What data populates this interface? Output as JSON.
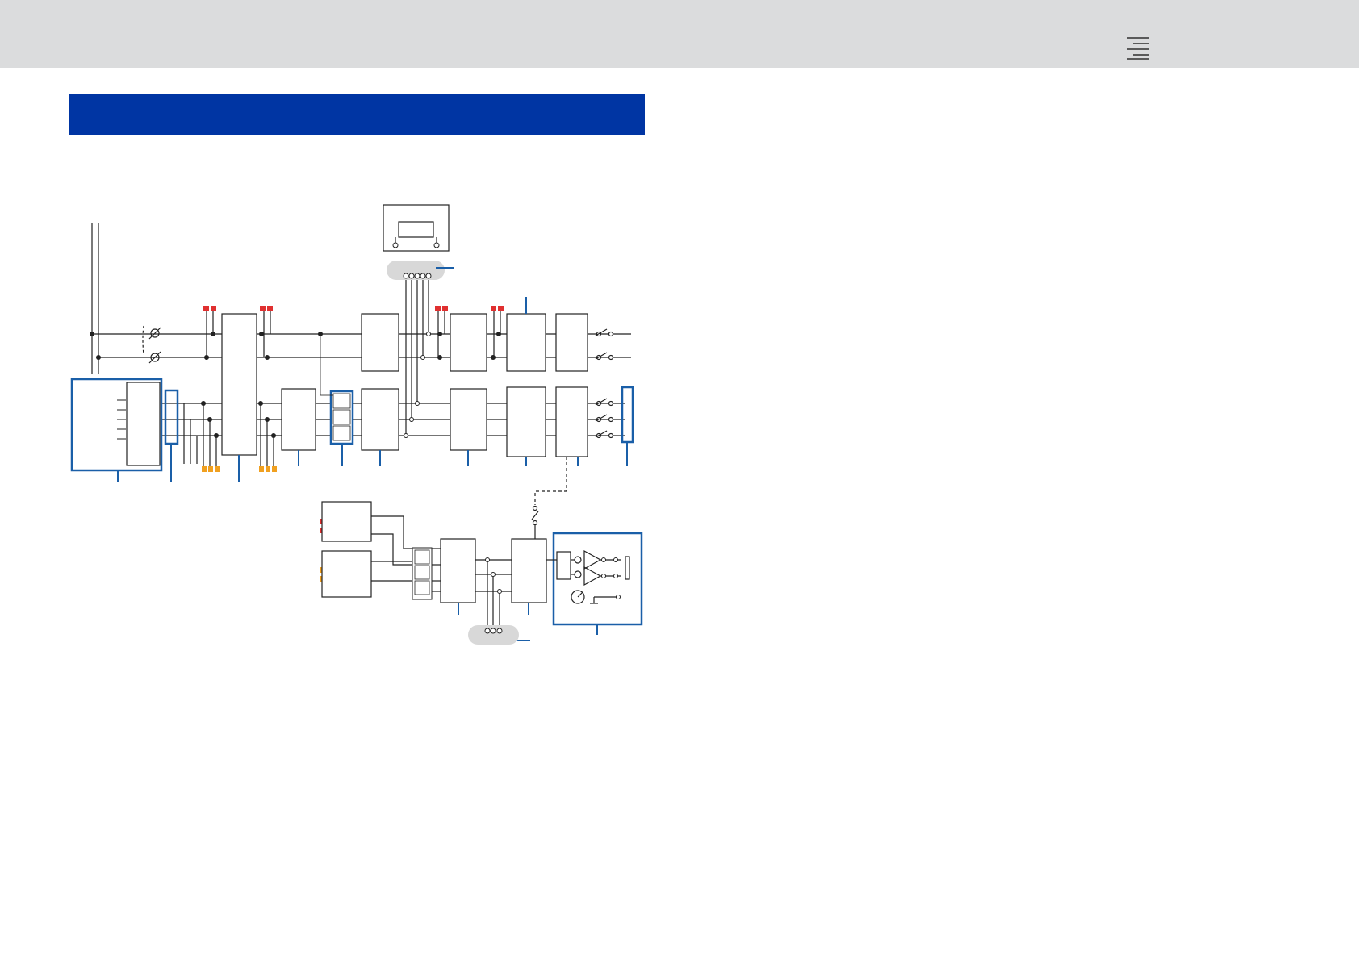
{
  "header": {
    "menu_icon": "menu-icon"
  },
  "section_banner": {
    "title": "",
    "color": "#0035a3"
  },
  "colors": {
    "line": "#222222",
    "highlight_blue": "#1a5fa8",
    "fuse_red": "#e03030",
    "fuse_orange": "#f0a020",
    "bus_pill": "#d8d8d8",
    "topbar": "#dbdcdd"
  }
}
